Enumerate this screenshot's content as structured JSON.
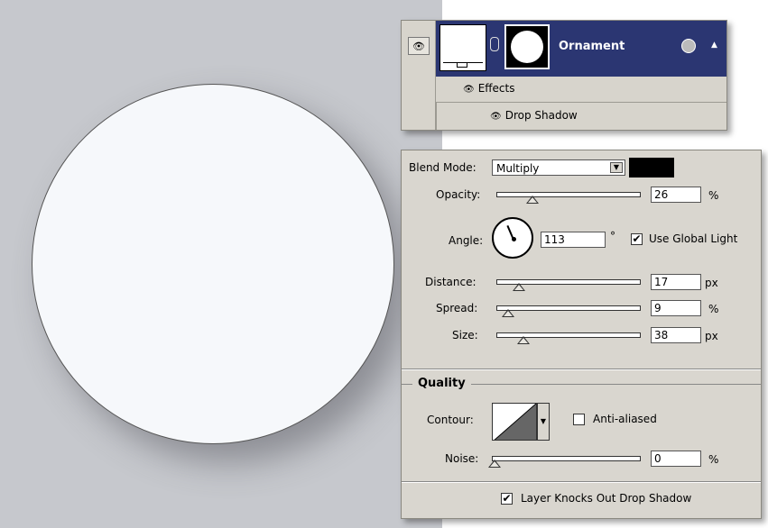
{
  "layers": {
    "layer_name": "Ornament",
    "effects_label": "Effects",
    "drop_shadow_label": "Drop Shadow",
    "eye_icon": "👁"
  },
  "drop_shadow": {
    "blend_mode_label": "Blend Mode:",
    "blend_mode_value": "Multiply",
    "shadow_color": "#000000",
    "opacity_label": "Opacity:",
    "opacity_value": "26",
    "opacity_unit": "%",
    "angle_label": "Angle:",
    "angle_value": "113",
    "angle_unit": "°",
    "use_global_light_label": "Use Global Light",
    "use_global_light_checked": true,
    "distance_label": "Distance:",
    "distance_value": "17",
    "distance_unit": "px",
    "spread_label": "Spread:",
    "spread_value": "9",
    "spread_unit": "%",
    "size_label": "Size:",
    "size_value": "38",
    "size_unit": "px",
    "quality_title": "Quality",
    "contour_label": "Contour:",
    "anti_aliased_label": "Anti-aliased",
    "anti_aliased_checked": false,
    "noise_label": "Noise:",
    "noise_value": "0",
    "noise_unit": "%",
    "knockout_label": "Layer Knocks Out Drop Shadow",
    "knockout_checked": true,
    "check_mark": "✔"
  }
}
